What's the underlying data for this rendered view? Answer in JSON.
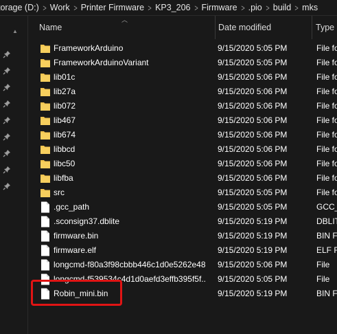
{
  "breadcrumb": [
    "torage (D:)",
    "Work",
    "Printer Firmware",
    "KP3_206",
    "Firmware",
    ".pio",
    "build",
    "mks"
  ],
  "columns": {
    "name": "Name",
    "date": "Date modified",
    "type": "Type"
  },
  "files": [
    {
      "name": "FrameworkArduino",
      "date": "9/15/2020 5:05 PM",
      "type": "File fo",
      "icon": "folder-icon"
    },
    {
      "name": "FrameworkArduinoVariant",
      "date": "9/15/2020 5:05 PM",
      "type": "File fo",
      "icon": "folder-icon"
    },
    {
      "name": "lib01c",
      "date": "9/15/2020 5:06 PM",
      "type": "File fo",
      "icon": "folder-icon"
    },
    {
      "name": "lib27a",
      "date": "9/15/2020 5:06 PM",
      "type": "File fo",
      "icon": "folder-icon"
    },
    {
      "name": "lib072",
      "date": "9/15/2020 5:06 PM",
      "type": "File fo",
      "icon": "folder-icon"
    },
    {
      "name": "lib467",
      "date": "9/15/2020 5:06 PM",
      "type": "File fo",
      "icon": "folder-icon"
    },
    {
      "name": "lib674",
      "date": "9/15/2020 5:06 PM",
      "type": "File fo",
      "icon": "folder-icon"
    },
    {
      "name": "libbcd",
      "date": "9/15/2020 5:06 PM",
      "type": "File fo",
      "icon": "folder-icon"
    },
    {
      "name": "libc50",
      "date": "9/15/2020 5:06 PM",
      "type": "File fo",
      "icon": "folder-icon"
    },
    {
      "name": "libfba",
      "date": "9/15/2020 5:06 PM",
      "type": "File fo",
      "icon": "folder-icon"
    },
    {
      "name": "src",
      "date": "9/15/2020 5:05 PM",
      "type": "File fo",
      "icon": "folder-icon"
    },
    {
      "name": ".gcc_path",
      "date": "9/15/2020 5:05 PM",
      "type": "GCC_",
      "icon": "file-icon"
    },
    {
      "name": ".sconsign37.dblite",
      "date": "9/15/2020 5:19 PM",
      "type": "DBLIT",
      "icon": "file-icon"
    },
    {
      "name": "firmware.bin",
      "date": "9/15/2020 5:19 PM",
      "type": "BIN F",
      "icon": "file-icon"
    },
    {
      "name": "firmware.elf",
      "date": "9/15/2020 5:19 PM",
      "type": "ELF Fi",
      "icon": "file-icon"
    },
    {
      "name": "longcmd-f80a3f98cbbb446c1d0e5262e48...",
      "date": "9/15/2020 5:06 PM",
      "type": "File",
      "icon": "file-icon"
    },
    {
      "name": "longcmd-f539534c4d1d0aefd3effb395f5f...",
      "date": "9/15/2020 5:05 PM",
      "type": "File",
      "icon": "file-icon"
    },
    {
      "name": "Robin_mini.bin",
      "date": "9/15/2020 5:19 PM",
      "type": "BIN F",
      "icon": "file-icon"
    }
  ],
  "colors": {
    "background": "#191919",
    "folder": "#f2c450",
    "highlight": "#e01414"
  }
}
